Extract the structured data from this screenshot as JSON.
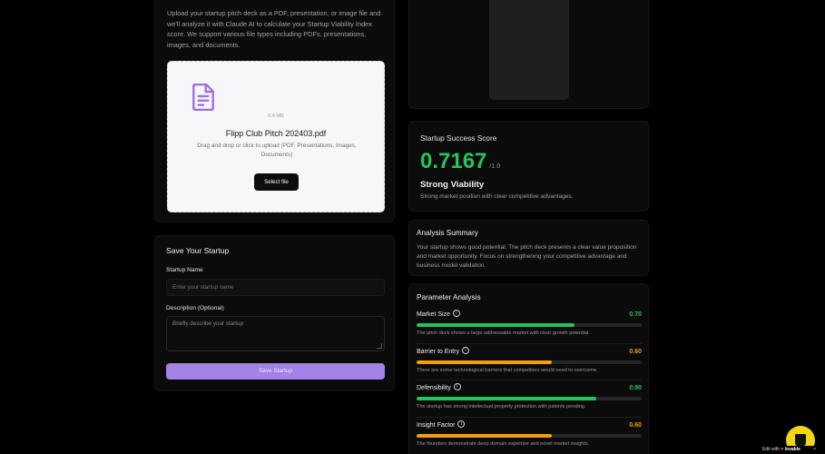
{
  "upload": {
    "intro": "Upload your startup pitch deck as a PDF, presentation, or image file and we'll analyze it with Claude AI to calculate your Startup Viability Index score. We support various file types including PDFs, presentations, images, and documents.",
    "file_size": "0.4 MB",
    "file_name": "Flipp Club Pitch 202403.pdf",
    "drop_hint": "Drag and drop or click to upload (PDF, Presentations, Images, Documents)",
    "select_label": "Select file",
    "icon": "document-icon"
  },
  "save_form": {
    "title": "Save Your Startup",
    "name_label": "Startup Name",
    "name_placeholder": "Enter your startup name",
    "name_value": "",
    "desc_label": "Description (Optional)",
    "desc_placeholder": "Briefly describe your startup",
    "desc_value": "",
    "save_label": "Save Startup"
  },
  "score": {
    "title": "Startup Success Score",
    "value": "0.7167",
    "suffix": "/1.0",
    "rating": "Strong Viability",
    "rating_desc": "Strong market position with clear competitive advantages."
  },
  "summary": {
    "title": "Analysis Summary",
    "text": "Your startup shows good potential. The pitch deck presents a clear value proposition and market opportunity. Focus on strengthening your competitive advantage and business model validation."
  },
  "parameters": {
    "title": "Parameter Analysis",
    "items": [
      {
        "name": "Market Size",
        "score": "0.70",
        "fraction": 0.7,
        "color": "#22c55e",
        "desc": "The pitch deck shows a large addressable market with clear growth potential."
      },
      {
        "name": "Barrier to Entry",
        "score": "0.60",
        "fraction": 0.6,
        "color": "#f59e0b",
        "desc": "There are some technological barriers that competitors would need to overcome."
      },
      {
        "name": "Defensibility",
        "score": "0.80",
        "fraction": 0.8,
        "color": "#22c55e",
        "desc": "The startup has strong intellectual property protection with patents pending."
      },
      {
        "name": "Insight Factor",
        "score": "0.60",
        "fraction": 0.6,
        "color": "#f59e0b",
        "desc": "The founders demonstrate deep domain expertise and novel market insights."
      }
    ]
  },
  "badge": {
    "prefix": "Edit with",
    "brand": "lovable",
    "close": "×"
  },
  "colors": {
    "accent_purple": "#a381e6",
    "success_green": "#22c55e",
    "warning_orange": "#f59e0b"
  }
}
